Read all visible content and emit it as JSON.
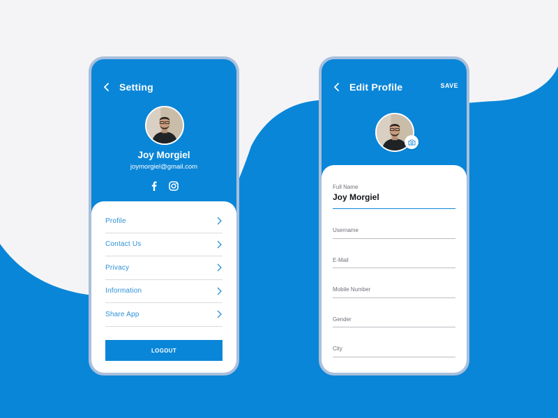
{
  "colors": {
    "primary": "#0a86d8",
    "background": "#f4f4f6",
    "phone_frame": "#a9bfdc",
    "menu_text": "#2b8fd6",
    "white": "#ffffff"
  },
  "setting_screen": {
    "header": {
      "back_icon": "chevron-left-icon",
      "title": "Setting"
    },
    "profile": {
      "name": "Joy Morgiel",
      "email": "joymorgiel@gmail.com",
      "social_icons": [
        "facebook-icon",
        "instagram-icon"
      ]
    },
    "menu": [
      {
        "label": "Profile"
      },
      {
        "label": "Contact Us"
      },
      {
        "label": "Privacy"
      },
      {
        "label": "Information"
      },
      {
        "label": "Share App"
      }
    ],
    "logout_label": "LOGOUT"
  },
  "edit_profile_screen": {
    "header": {
      "back_icon": "chevron-left-icon",
      "title": "Edit Profile",
      "save_label": "SAVE"
    },
    "camera_icon": "camera-icon",
    "fields": [
      {
        "label": "Full Name",
        "value": "Joy Morgiel"
      },
      {
        "label": "Username",
        "value": ""
      },
      {
        "label": "E-Mail",
        "value": ""
      },
      {
        "label": "Mobile Number",
        "value": ""
      },
      {
        "label": "Gender",
        "value": ""
      },
      {
        "label": "City",
        "value": ""
      }
    ]
  }
}
